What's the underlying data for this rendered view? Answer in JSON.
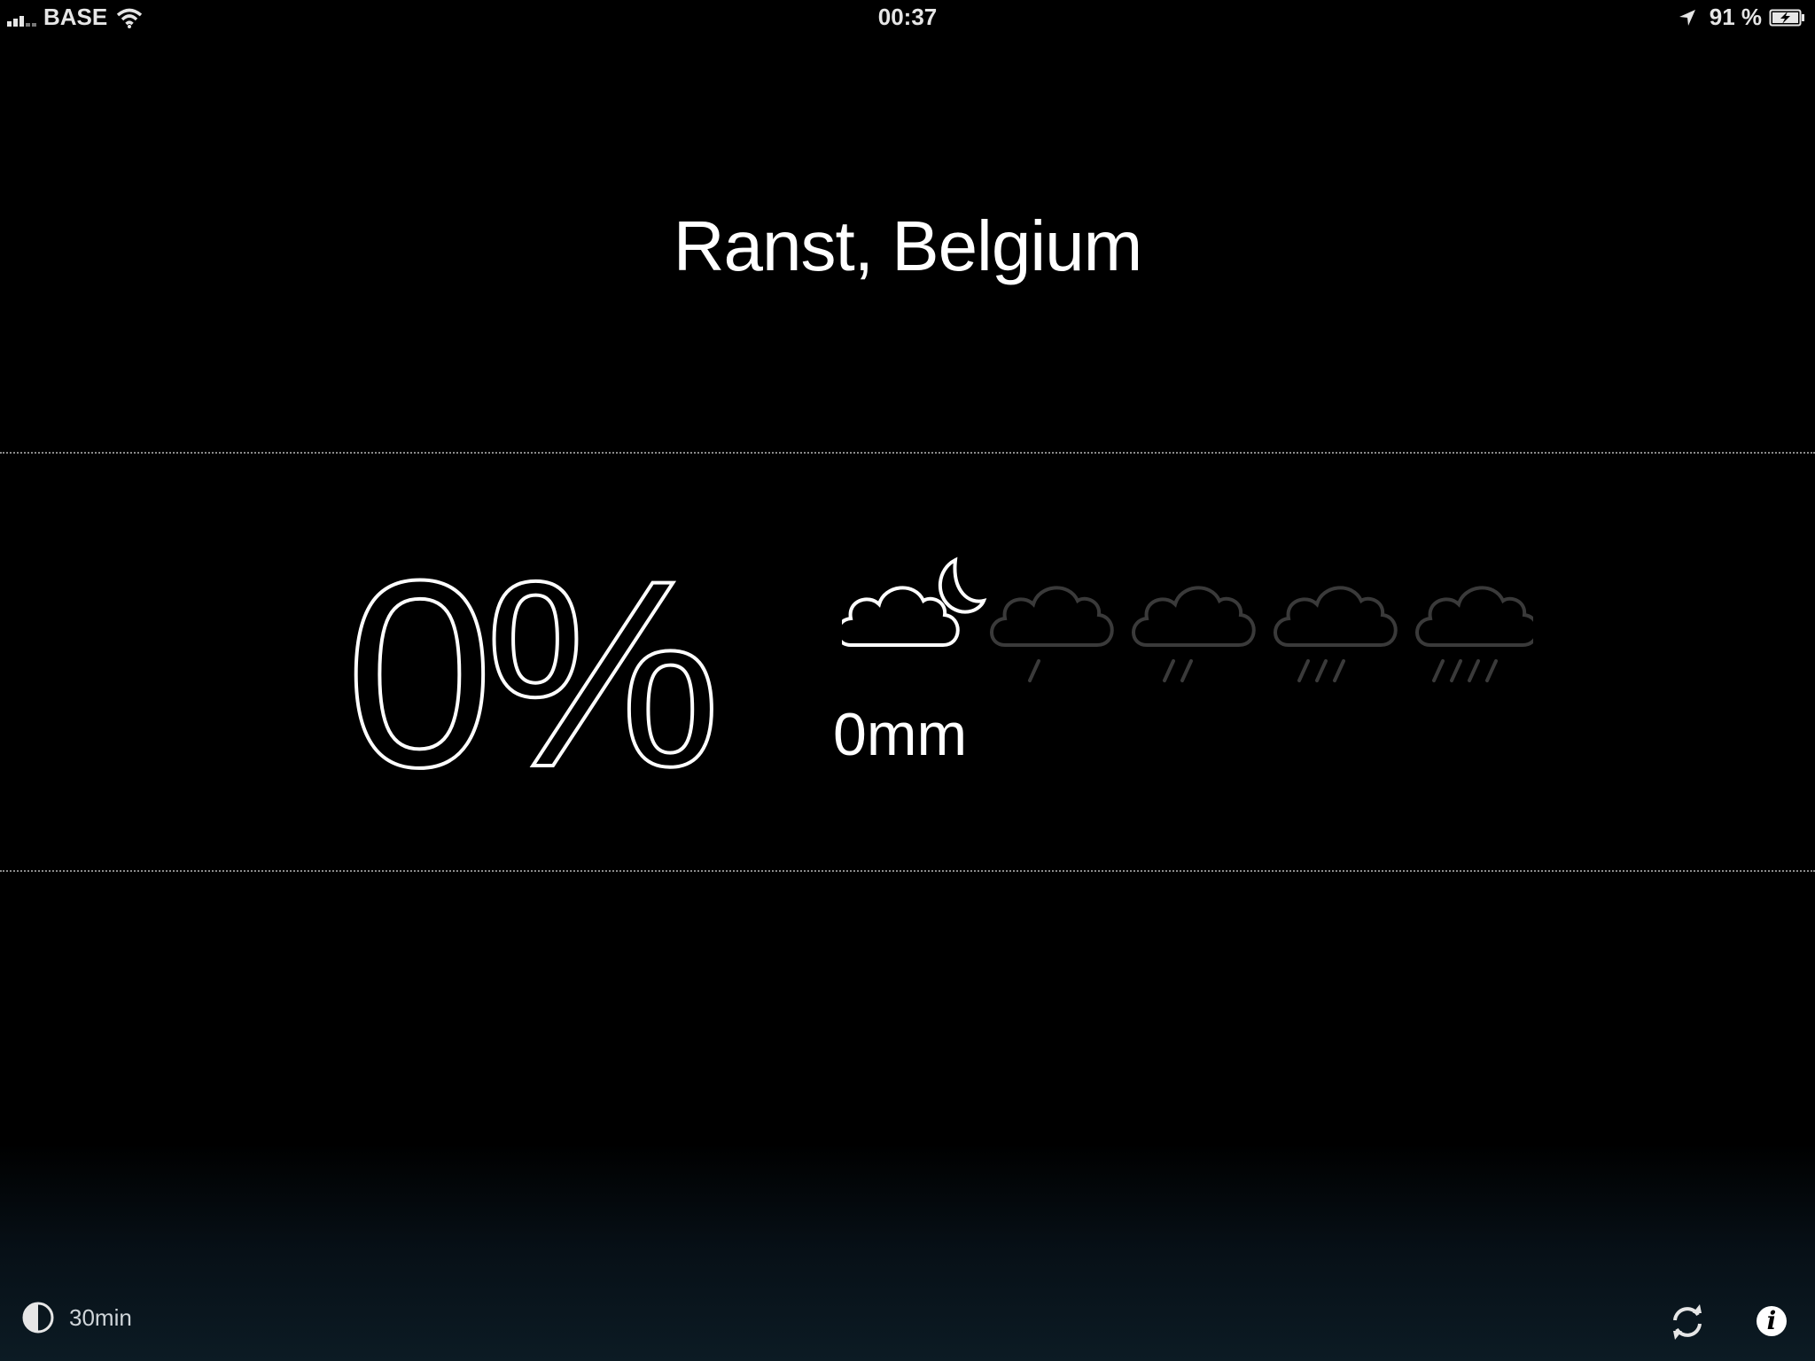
{
  "status_bar": {
    "carrier": "BASE",
    "time": "00:37",
    "battery": "91 %",
    "icons": [
      "signal-icon",
      "wifi-icon",
      "location-arrow-icon",
      "battery-charging-icon"
    ]
  },
  "location": "Ranst, Belgium",
  "precipitation": {
    "chance": "0%",
    "amount": "0mm",
    "current_condition": "partly-cloudy-night",
    "scale_icons": [
      "cloud-moon-icon",
      "cloud-rain-1-icon",
      "cloud-rain-2-icon",
      "cloud-rain-3-icon",
      "cloud-rain-4-icon"
    ],
    "active_level": 0
  },
  "bottom_bar": {
    "interval": "30min",
    "icons": [
      "half-circle-icon",
      "refresh-icon",
      "info-icon"
    ]
  },
  "colors": {
    "background": "#000000",
    "active_icon": "#ffffff",
    "inactive_icon": "#3a3a3a",
    "divider": "#8a8a8a",
    "gradient_bottom": "#0c1b24"
  }
}
